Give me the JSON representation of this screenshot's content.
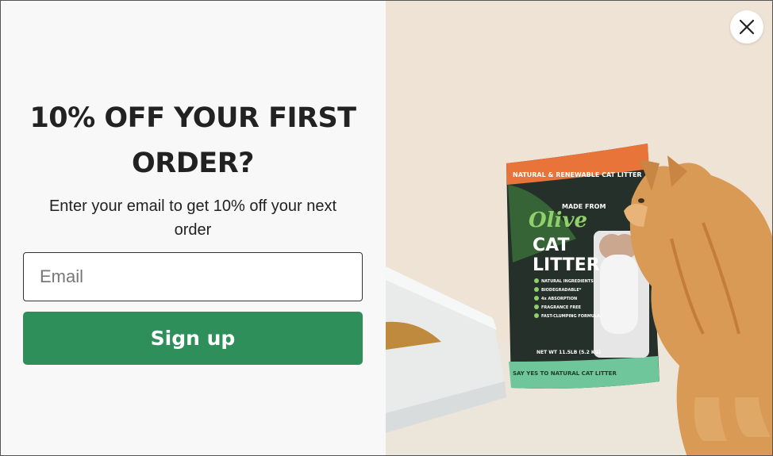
{
  "popup": {
    "headline": "10% OFF YOUR FIRST ORDER?",
    "subtext": "Enter your email to get 10% off your next order",
    "email_placeholder": "Email",
    "email_value": "",
    "signup_label": "Sign up",
    "close_icon": "close-icon"
  },
  "image": {
    "brand": "Olive",
    "made_from_label": "MADE FROM",
    "product_name_line1": "CAT",
    "product_name_line2": "LITTER",
    "top_banner": "NATURAL & RENEWABLE CAT LITTER",
    "bottom_banner": "SAY YES TO NATURAL CAT LITTER",
    "weight_text": "NET WT 11.5LB (5.2 KG)",
    "features": [
      "NATURAL INGREDIENTS",
      "BIODEGRADABLE*",
      "4x ABSORPTION",
      "FRAGRANCE FREE",
      "FAST-CLUMPING FORMULA"
    ]
  },
  "colors": {
    "signup_bg": "#2f8f5a",
    "panel_bg": "#f8f8f8",
    "photo_bg": "#efe4d7"
  }
}
